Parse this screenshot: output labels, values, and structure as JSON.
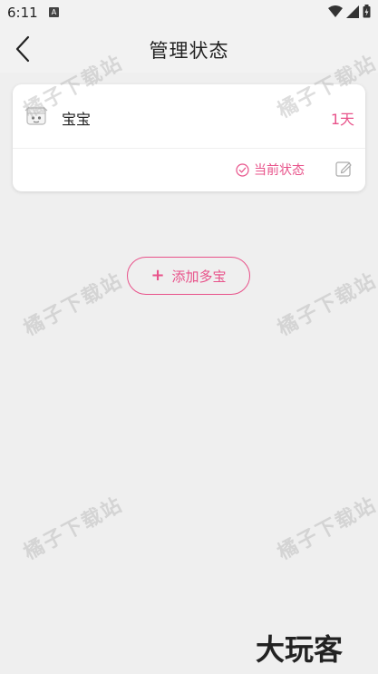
{
  "statusbar": {
    "time": "6:11",
    "notification_icon": "A"
  },
  "header": {
    "title": "管理状态"
  },
  "baby_card": {
    "name": "宝宝",
    "days": "1天",
    "status_label": "当前状态",
    "accent_color": "#e8528a"
  },
  "add_button": {
    "plus": "+",
    "label": "添加多宝"
  },
  "watermark": {
    "text": "橘子下载站"
  },
  "brand": {
    "text": "大玩客"
  }
}
